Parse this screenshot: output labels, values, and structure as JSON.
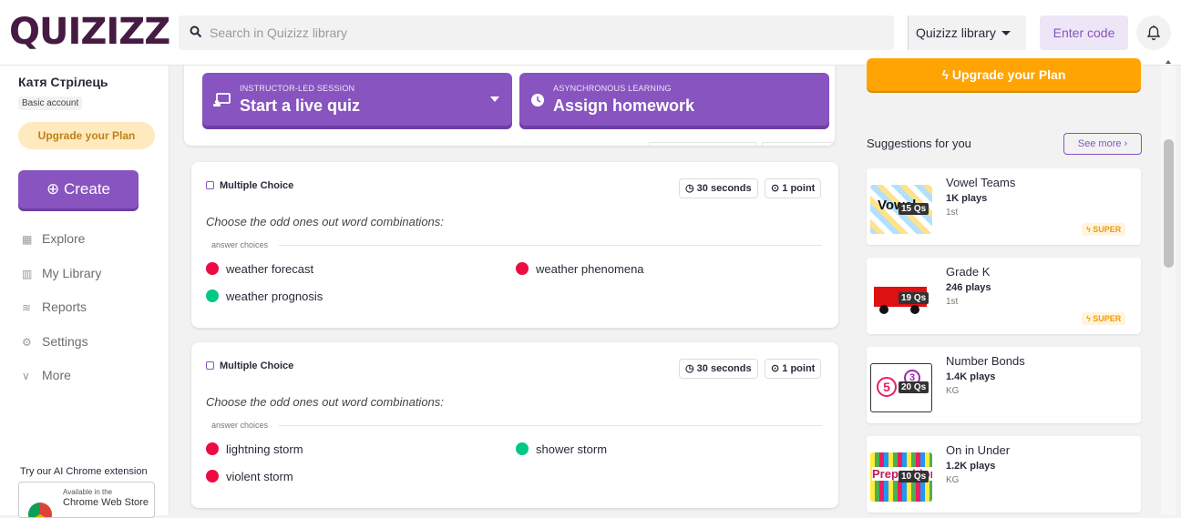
{
  "header": {
    "logo": "QUIZIZZ",
    "search_placeholder": "Search in Quizizz library",
    "library_select": "Quizizz library",
    "enter_code": "Enter code"
  },
  "sidebar": {
    "user_name": "Катя Стрілець",
    "account_type": "Basic account",
    "upgrade": "Upgrade your Plan",
    "create": "Create",
    "nav": [
      {
        "label": "Explore",
        "icon": "explore-icon"
      },
      {
        "label": "My Library",
        "icon": "library-icon"
      },
      {
        "label": "Reports",
        "icon": "reports-icon"
      },
      {
        "label": "Settings",
        "icon": "settings-icon"
      },
      {
        "label": "More",
        "icon": "chevron-down-icon"
      }
    ],
    "extension_title": "Try our AI Chrome extension",
    "extension_sub": "Available in the",
    "extension_store": "Chrome Web Store"
  },
  "session": {
    "live": {
      "sub": "INSTRUCTOR-LED SESSION",
      "main": "Start a live quiz"
    },
    "homework": {
      "sub": "ASYNCHRONOUS LEARNING",
      "main": "Assign homework"
    }
  },
  "questions": [
    {
      "type": "Multiple Choice",
      "time": "30 seconds",
      "points": "1 point",
      "text": "Choose the odd ones out word combinations:",
      "answer_label": "answer choices",
      "answers": [
        {
          "text": "weather forecast",
          "correct": false
        },
        {
          "text": "weather phenomena",
          "correct": false
        },
        {
          "text": "weather prognosis",
          "correct": true
        }
      ]
    },
    {
      "type": "Multiple Choice",
      "time": "30 seconds",
      "points": "1 point",
      "text": "Choose the odd ones out word combinations:",
      "answer_label": "answer choices",
      "answers": [
        {
          "text": "lightning storm",
          "correct": false
        },
        {
          "text": "shower storm",
          "correct": true
        },
        {
          "text": "violent storm",
          "correct": false
        }
      ]
    }
  ],
  "right": {
    "upgrade": "Upgrade your Plan",
    "suggestions_title": "Suggestions for you",
    "see_more": "See more",
    "suggestions": [
      {
        "title": "Vowel Teams",
        "plays": "1K plays",
        "grade": "1st",
        "qs": "15 Qs",
        "super": "SUPER"
      },
      {
        "title": "Grade K",
        "plays": "246 plays",
        "grade": "1st",
        "qs": "19 Qs",
        "super": "SUPER"
      },
      {
        "title": "Number Bonds",
        "plays": "1.4K plays",
        "grade": "KG",
        "qs": "20 Qs"
      },
      {
        "title": "On in Under",
        "plays": "1.2K plays",
        "grade": "KG",
        "qs": "10 Qs"
      }
    ]
  },
  "colors": {
    "brand_purple": "#8854c0",
    "wrong": "#ec0b43",
    "correct": "#00c985",
    "upgrade_orange": "#ffa402"
  }
}
